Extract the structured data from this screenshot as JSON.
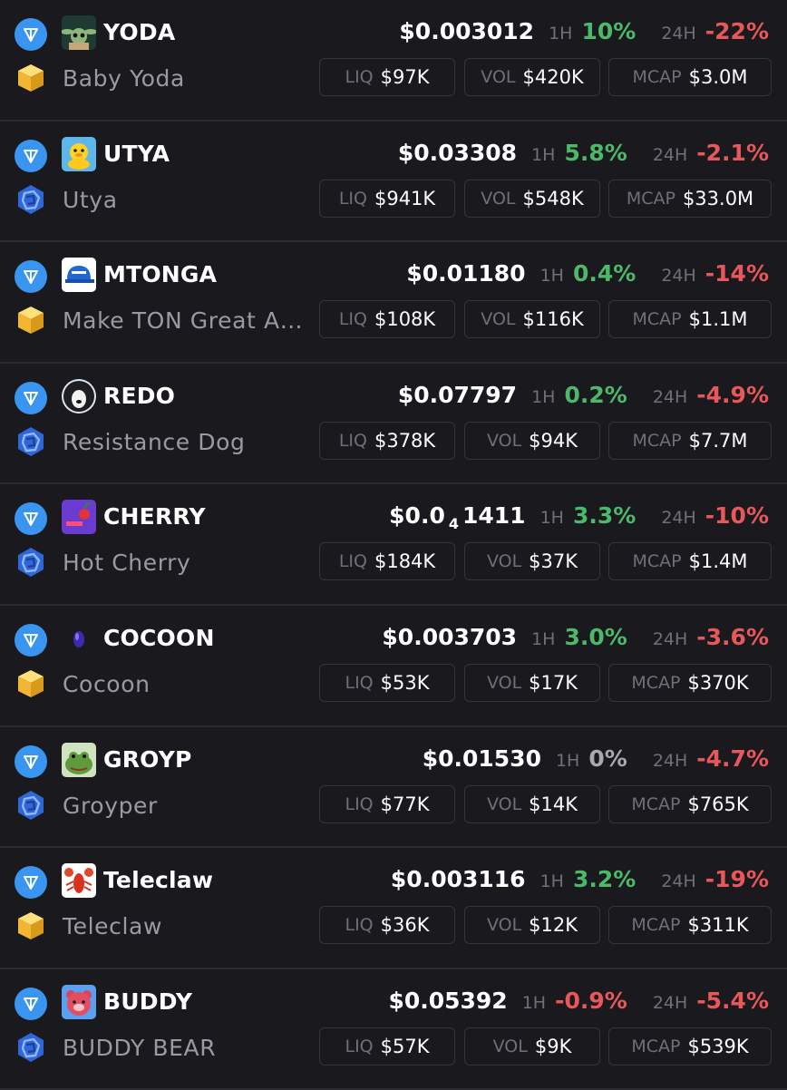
{
  "labels": {
    "h1": "1H",
    "h24": "24H",
    "liq": "LIQ",
    "vol": "VOL",
    "mcap": "MCAP"
  },
  "colors": {
    "up": "#4cb96a",
    "down": "#e8575a",
    "flat": "#a8a8ae",
    "chain_badge": "#3a95f0"
  },
  "icons": {
    "chain": "ton-chain-icon",
    "dex_cube": "stonfi-dex-icon",
    "dex_hex": "dedust-dex-icon"
  },
  "tokens": [
    {
      "symbol": "YODA",
      "name": "Baby Yoda",
      "price": "$0.003012",
      "h1": "10%",
      "h1_dir": "up",
      "h24": "-22%",
      "h24_dir": "down",
      "liq": "$97K",
      "vol": "$420K",
      "mcap": "$3.0M",
      "dex": "cube",
      "avatar": "baby-yoda-avatar"
    },
    {
      "symbol": "UTYA",
      "name": "Utya",
      "price": "$0.03308",
      "h1": "5.8%",
      "h1_dir": "up",
      "h24": "-2.1%",
      "h24_dir": "down",
      "liq": "$941K",
      "vol": "$548K",
      "mcap": "$33.0M",
      "dex": "hex",
      "avatar": "duck-avatar"
    },
    {
      "symbol": "MTONGA",
      "name": "Make TON Great A…",
      "price": "$0.01180",
      "h1": "0.4%",
      "h1_dir": "up",
      "h24": "-14%",
      "h24_dir": "down",
      "liq": "$108K",
      "vol": "$116K",
      "mcap": "$1.1M",
      "dex": "cube",
      "avatar": "blue-cap-avatar"
    },
    {
      "symbol": "REDO",
      "name": "Resistance Dog",
      "price": "$0.07797",
      "h1": "0.2%",
      "h1_dir": "up",
      "h24": "-4.9%",
      "h24_dir": "down",
      "liq": "$378K",
      "vol": "$94K",
      "mcap": "$7.7M",
      "dex": "hex",
      "avatar": "dog-avatar"
    },
    {
      "symbol": "CHERRY",
      "name": "Hot Cherry",
      "price_main": "$0.0",
      "price_sub": "4",
      "price_tail": "1411",
      "h1": "3.3%",
      "h1_dir": "up",
      "h24": "-10%",
      "h24_dir": "down",
      "liq": "$184K",
      "vol": "$37K",
      "mcap": "$1.4M",
      "dex": "hex",
      "avatar": "cherry-avatar"
    },
    {
      "symbol": "COCOON",
      "name": "Cocoon",
      "price": "$0.003703",
      "h1": "3.0%",
      "h1_dir": "up",
      "h24": "-3.6%",
      "h24_dir": "down",
      "liq": "$53K",
      "vol": "$17K",
      "mcap": "$370K",
      "dex": "cube",
      "avatar": "cocoon-avatar"
    },
    {
      "symbol": "GROYP",
      "name": "Groyper",
      "price": "$0.01530",
      "h1": "0%",
      "h1_dir": "flat",
      "h24": "-4.7%",
      "h24_dir": "down",
      "liq": "$77K",
      "vol": "$14K",
      "mcap": "$765K",
      "dex": "hex",
      "avatar": "frog-avatar"
    },
    {
      "symbol": "Teleclaw",
      "name": "Teleclaw",
      "price": "$0.003116",
      "h1": "3.2%",
      "h1_dir": "up",
      "h24": "-19%",
      "h24_dir": "down",
      "liq": "$36K",
      "vol": "$12K",
      "mcap": "$311K",
      "dex": "cube",
      "avatar": "lobster-avatar"
    },
    {
      "symbol": "BUDDY",
      "name": "BUDDY BEAR",
      "price": "$0.05392",
      "h1": "-0.9%",
      "h1_dir": "down",
      "h24": "-5.4%",
      "h24_dir": "down",
      "liq": "$57K",
      "vol": "$9K",
      "mcap": "$539K",
      "dex": "hex",
      "avatar": "bear-avatar"
    }
  ]
}
